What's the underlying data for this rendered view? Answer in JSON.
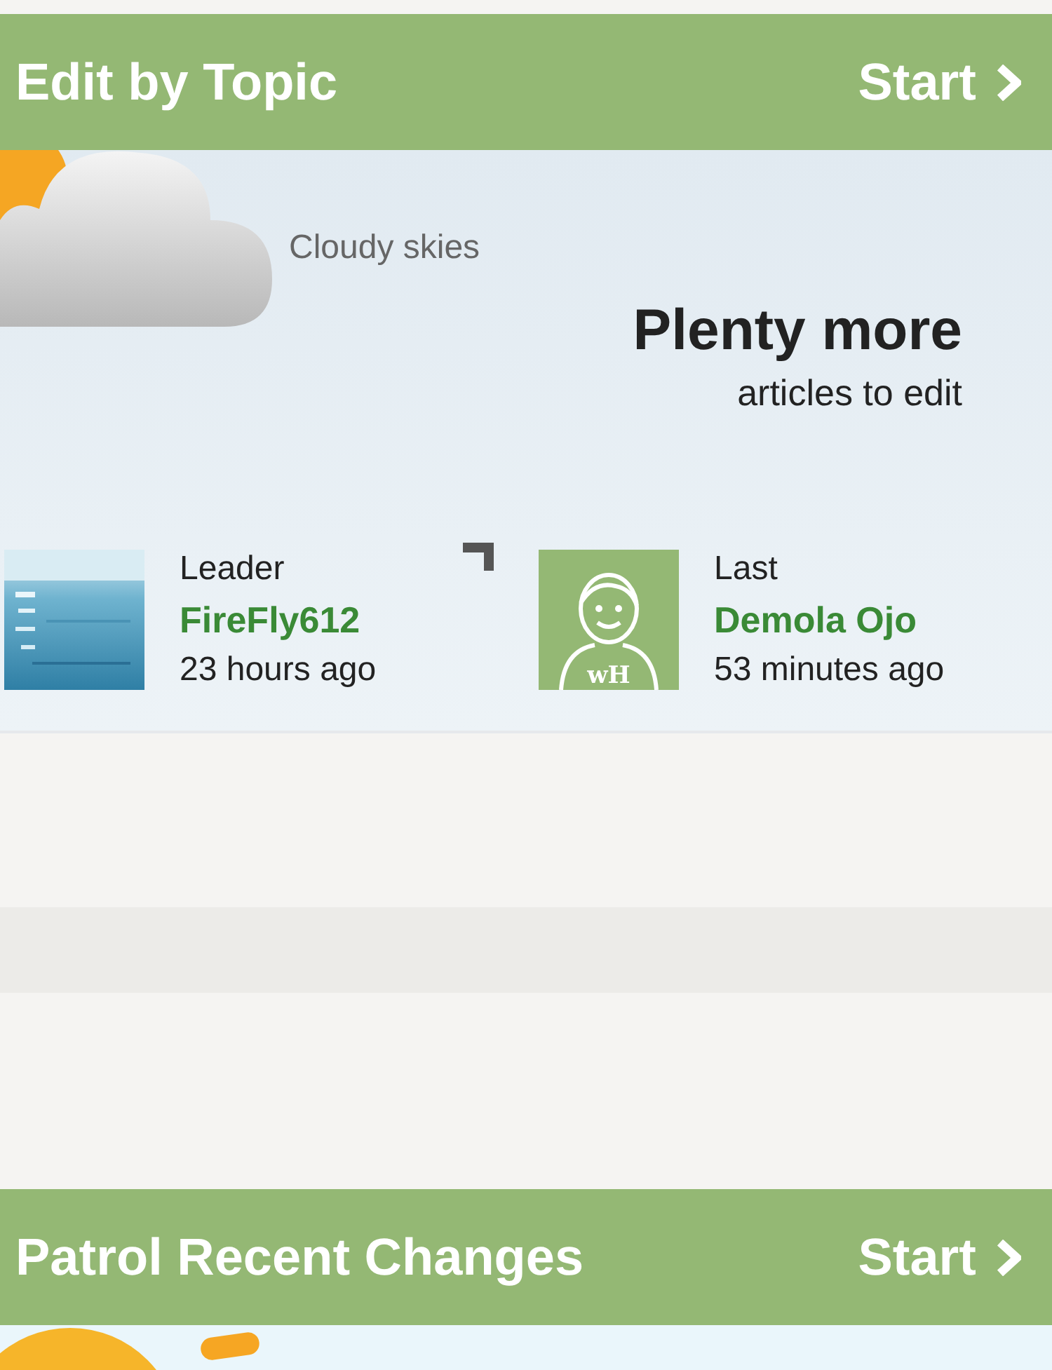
{
  "sections": [
    {
      "title": "Edit by Topic",
      "action": "Start",
      "weather": "Cloudy skies",
      "headline": "Plenty more",
      "subline": "articles to edit",
      "stats": [
        {
          "label": "Leader",
          "name": "FireFly612",
          "time": "23 hours ago",
          "kind": "picture"
        },
        {
          "label": "Last",
          "name": "Demola Ojo",
          "time": "53 minutes ago",
          "kind": "avatar",
          "avatar_label": "wH"
        }
      ]
    },
    {
      "title": "Patrol Recent Changes",
      "action": "Start"
    }
  ]
}
